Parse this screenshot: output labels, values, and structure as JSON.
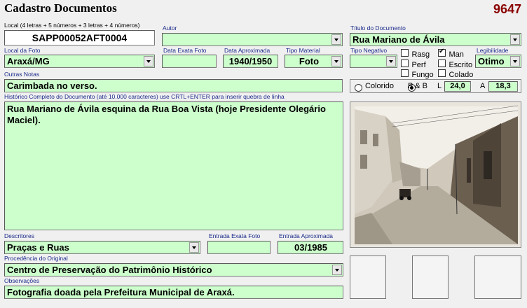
{
  "header": {
    "title": "Cadastro Documentos",
    "record_number": "9647"
  },
  "local": {
    "label": "Local (4 letras + 5 números + 3 letras + 4 números)",
    "value": "SAPP00052AFT0004"
  },
  "autor": {
    "label": "Autor",
    "value": ""
  },
  "titulo": {
    "label": "Título do Documento",
    "value": "Rua Mariano de Ávila"
  },
  "local_foto": {
    "label": "Local da Foto",
    "value": "Araxá/MG"
  },
  "data_exata_foto": {
    "label": "Data Exata Foto",
    "value": ""
  },
  "data_aproximada": {
    "label": "Data Aproximada",
    "value": "1940/1950"
  },
  "tipo_material": {
    "label": "Tipo Material",
    "value": "Foto"
  },
  "tipo_negativo": {
    "label": "Tipo Negativo",
    "value": ""
  },
  "checks": {
    "rasg": {
      "label": "Rasg",
      "checked": false
    },
    "man": {
      "label": "Man",
      "checked": true
    },
    "perf": {
      "label": "Perf",
      "checked": false
    },
    "escrito": {
      "label": "Escrito",
      "checked": false
    },
    "fungo": {
      "label": "Fungo",
      "checked": false
    },
    "colado": {
      "label": "Colado",
      "checked": false
    }
  },
  "legibilidade": {
    "label": "Legibilidade",
    "value": "Otimo"
  },
  "outras_notas": {
    "label": "Outras Notas",
    "value": "Carimbada no verso."
  },
  "color": {
    "colorido": "Colorido",
    "pb": "P & B",
    "selected": "pb"
  },
  "dimensions": {
    "l_label": "L",
    "l_value": "24,0",
    "a_label": "A",
    "a_value": "18,3"
  },
  "historico": {
    "label": "Histórico Completo do Documento (até 10.000 caracteres) use CRTL+ENTER para inserir quebra de linha",
    "value": "Rua Mariano de Ávila esquina da Rua Boa Vista (hoje Presidente Olegário Maciel)."
  },
  "descritores": {
    "label": "Descritores",
    "value": "Praças e Ruas"
  },
  "entrada_exata": {
    "label": "Entrada Exata Foto",
    "value": ""
  },
  "entrada_aproximada": {
    "label": "Entrada Aproximada",
    "value": "03/1985"
  },
  "procedencia": {
    "label": "Procedência do Original",
    "value": "Centro de Preservação do Patrimônio Histórico"
  },
  "observacoes": {
    "label": "Observações",
    "value": "Fotografia doada pela Prefeitura Municipal de Araxá."
  },
  "icons": {
    "dropdown": "chevron-down-icon"
  }
}
